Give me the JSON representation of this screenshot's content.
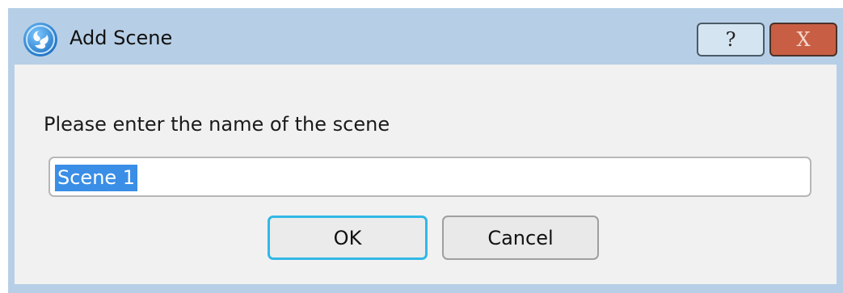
{
  "window": {
    "title": "Add Scene",
    "help_label": "?",
    "close_label": "X"
  },
  "dialog": {
    "prompt": "Please enter the name of the scene",
    "scene_name_value": "Scene 1",
    "ok_label": "OK",
    "cancel_label": "Cancel"
  },
  "icons": {
    "app": "obs-logo-icon",
    "help": "help-icon",
    "close": "close-icon"
  },
  "colors": {
    "titlebar_bg": "#b7cfe6",
    "content_bg": "#f1f1f1",
    "close_bg": "#c85f45",
    "focus_border": "#31b8e6",
    "selection_bg": "#3a8ee6"
  }
}
